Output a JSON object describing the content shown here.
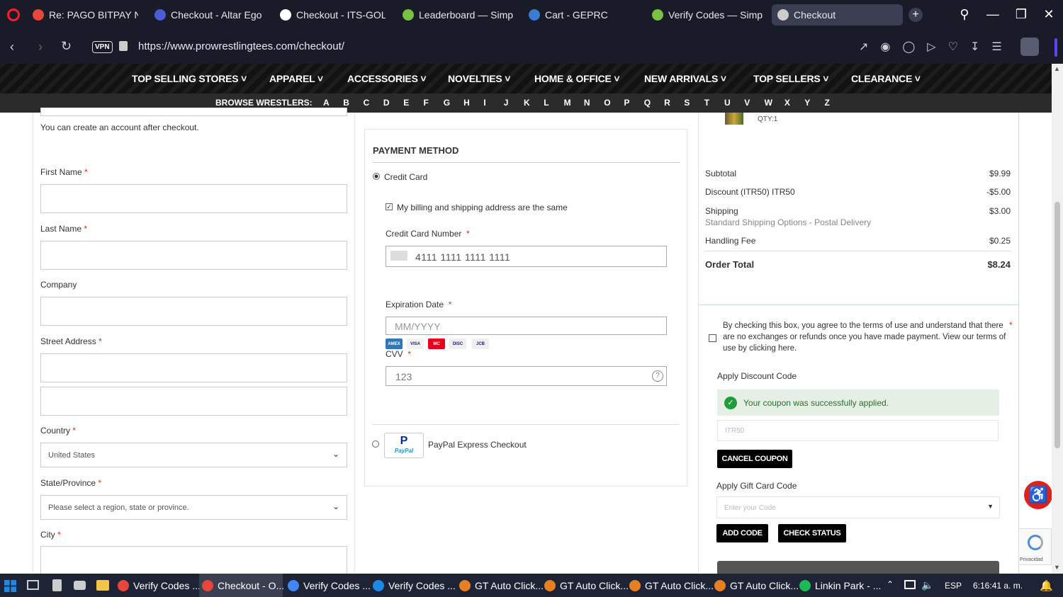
{
  "tabs": [
    {
      "label": "Re: PAGO BITPAY NO REC",
      "color": "#e8453c"
    },
    {
      "label": "Checkout - Altar Ego",
      "color": "#4d5bd6"
    },
    {
      "label": "Checkout - ITS-GOLF",
      "color": "#ffffff"
    },
    {
      "label": "Leaderboard — SimplyC",
      "color": "#7bc043"
    },
    {
      "label": "Cart - GEPRC",
      "color": "#3a7bd5"
    },
    {
      "label": "Verify Codes — SimplyC",
      "color": "#7bc043"
    },
    {
      "label": "Checkout",
      "color": "#cccccc"
    }
  ],
  "url": "https://www.prowrestlingtees.com/checkout/",
  "vpn": "VPN",
  "nav": {
    "items": [
      "TOP SELLING STORES",
      "APPAREL",
      "ACCESSORIES",
      "NOVELTIES",
      "HOME & OFFICE",
      "NEW ARRIVALS",
      "TOP SELLERS",
      "CLEARANCE"
    ],
    "browse_label": "BROWSE WRESTLERS:",
    "letters": [
      "A",
      "B",
      "C",
      "D",
      "E",
      "F",
      "G",
      "H",
      "I",
      "J",
      "K",
      "L",
      "M",
      "N",
      "O",
      "P",
      "Q",
      "R",
      "S",
      "T",
      "U",
      "V",
      "W",
      "X",
      "Y",
      "Z"
    ]
  },
  "left_form": {
    "account_note": "You can create an account after checkout.",
    "first_name": "First Name",
    "last_name": "Last Name",
    "company": "Company",
    "street": "Street Address",
    "country": "Country",
    "country_value": "United States",
    "state": "State/Province",
    "state_placeholder": "Please select a region, state or province.",
    "city": "City",
    "req": "*"
  },
  "payment": {
    "title": "PAYMENT METHOD",
    "credit_card": "Credit Card",
    "same_address": "My billing and shipping address are the same",
    "cc_number_label": "Credit Card Number",
    "cc_number": "4111 1111 1111 1111",
    "exp_label": "Expiration Date",
    "exp_placeholder": "MM/YYYY",
    "cvv_label": "CVV",
    "cvv_value": "123",
    "paypal": "PayPal Express Checkout",
    "paypal_logo": "PayPal",
    "cards": [
      {
        "name": "amex-icon",
        "text": "AMEX",
        "color": "#2e77bb"
      },
      {
        "name": "visa-icon",
        "text": "VISA",
        "color": "#f2f2f2"
      },
      {
        "name": "mastercard-icon",
        "text": "MC",
        "color": "#eb001b"
      },
      {
        "name": "discover-icon",
        "text": "DISC",
        "color": "#eeeeee"
      },
      {
        "name": "jcb-icon",
        "text": "JCB",
        "color": "#eeeeee"
      }
    ]
  },
  "summary": {
    "qty": "QTY:1",
    "subtotal_label": "Subtotal",
    "subtotal": "$9.99",
    "discount_label": "Discount (ITR50) ITR50",
    "discount": "-$5.00",
    "shipping_label": "Shipping",
    "shipping": "$3.00",
    "shipping_method": "Standard Shipping Options - Postal Delivery",
    "handling_label": "Handling Fee",
    "handling": "$0.25",
    "total_label": "Order Total",
    "total": "$8.24"
  },
  "terms": "By checking this box, you agree to the terms of use and understand that there are no exchanges or refunds once you have made payment. View our terms of use by clicking here.",
  "discount": {
    "label": "Apply Discount Code",
    "success": "Your coupon was successfully applied.",
    "code": "ITR50",
    "cancel": "CANCEL COUPON"
  },
  "giftcard": {
    "label": "Apply Gift Card Code",
    "placeholder": "Enter your Code",
    "add": "ADD CODE",
    "check": "CHECK STATUS"
  },
  "recaptcha": "Privacidad",
  "taskbar": {
    "items": [
      {
        "label": "Verify Codes ...",
        "color": "#e8453c"
      },
      {
        "label": "Checkout - O...",
        "color": "#e8453c"
      },
      {
        "label": "Verify Codes ...",
        "color": "#4285f4"
      },
      {
        "label": "Verify Codes ...",
        "color": "#1e88e5"
      },
      {
        "label": "GT Auto Click...",
        "color": "#e67e22"
      },
      {
        "label": "GT Auto Click...",
        "color": "#e67e22"
      },
      {
        "label": "GT Auto Click...",
        "color": "#e67e22"
      },
      {
        "label": "GT Auto Click...",
        "color": "#e67e22"
      },
      {
        "label": "Linkin Park - ...",
        "color": "#1db954"
      }
    ],
    "lang": "ESP",
    "time": "6:16:41 a. m."
  }
}
